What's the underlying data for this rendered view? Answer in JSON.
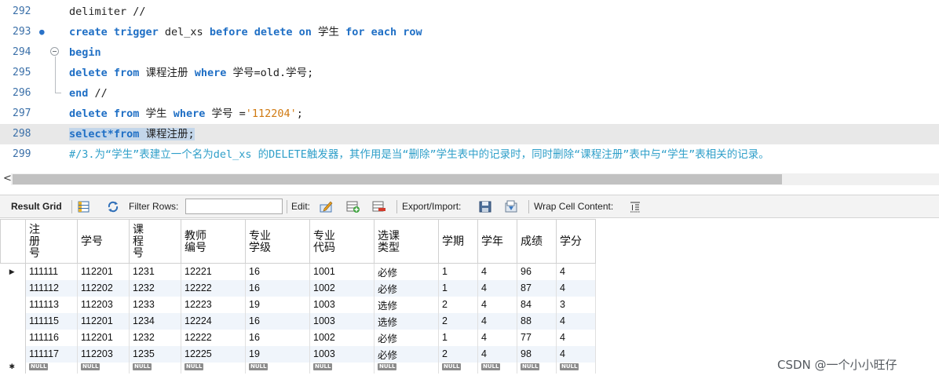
{
  "editor": {
    "lines": [
      {
        "num": "292",
        "marker": "",
        "fold": "",
        "tokens": [
          {
            "t": "delimiter //",
            "c": "plain"
          }
        ]
      },
      {
        "num": "293",
        "marker": "●",
        "fold": "",
        "tokens": [
          {
            "t": "create trigger ",
            "c": "kw"
          },
          {
            "t": "del_xs ",
            "c": "plain"
          },
          {
            "t": "before delete on ",
            "c": "kw"
          },
          {
            "t": "学生 ",
            "c": "plain"
          },
          {
            "t": "for each row",
            "c": "kw"
          }
        ]
      },
      {
        "num": "294",
        "marker": "",
        "fold": "open",
        "tokens": [
          {
            "t": "begin",
            "c": "kw"
          }
        ]
      },
      {
        "num": "295",
        "marker": "",
        "fold": "",
        "tokens": [
          {
            "t": "delete from ",
            "c": "kw"
          },
          {
            "t": "课程注册 ",
            "c": "plain"
          },
          {
            "t": "where ",
            "c": "kw"
          },
          {
            "t": "学号=old.学号;",
            "c": "plain"
          }
        ]
      },
      {
        "num": "296",
        "marker": "",
        "fold": "",
        "tokens": [
          {
            "t": "end ",
            "c": "kw"
          },
          {
            "t": "//",
            "c": "plain"
          }
        ]
      },
      {
        "num": "297",
        "marker": "",
        "fold": "",
        "tokens": [
          {
            "t": "delete from ",
            "c": "kw"
          },
          {
            "t": "学生 ",
            "c": "plain"
          },
          {
            "t": "where ",
            "c": "kw"
          },
          {
            "t": "学号 =",
            "c": "plain"
          },
          {
            "t": "'112204'",
            "c": "str"
          },
          {
            "t": ";",
            "c": "plain"
          }
        ]
      },
      {
        "num": "298",
        "marker": "",
        "fold": "",
        "current": true,
        "tokens": [
          {
            "t": "select*from ",
            "c": "kw sel"
          },
          {
            "t": "课程注册;",
            "c": "plain sel"
          }
        ]
      },
      {
        "num": "299",
        "marker": "",
        "fold": "",
        "tokens": [
          {
            "t": "#/3.为“学生”表建立一个名为del_xs 的DELETE触发器，其作用是当“删除”学生表中的记录时，同时删除“课程注册”表中与“学生”表相关的记录。",
            "c": "cmt"
          }
        ]
      }
    ]
  },
  "scrollbar": {
    "left_arrow": "<"
  },
  "toolbar": {
    "result_grid": "Result Grid",
    "filter_rows": "Filter Rows:",
    "filter_value": "",
    "edit": "Edit:",
    "export_import": "Export/Import:",
    "wrap_cell": "Wrap Cell Content:"
  },
  "grid": {
    "columns": [
      "注册号",
      "学号",
      "课程号",
      "教师编号",
      "专业学级",
      "专业代码",
      "选课类型",
      "学期",
      "学年",
      "成绩",
      "学分"
    ],
    "rows": [
      [
        "111111",
        "112201",
        "1231",
        "12221",
        "16",
        "1001",
        "必修",
        "1",
        "4",
        "96",
        "4"
      ],
      [
        "111112",
        "112202",
        "1232",
        "12222",
        "16",
        "1002",
        "必修",
        "1",
        "4",
        "87",
        "4"
      ],
      [
        "111113",
        "112203",
        "1233",
        "12223",
        "19",
        "1003",
        "选修",
        "2",
        "4",
        "84",
        "3"
      ],
      [
        "111115",
        "112201",
        "1234",
        "12224",
        "16",
        "1003",
        "选修",
        "2",
        "4",
        "88",
        "4"
      ],
      [
        "111116",
        "112201",
        "1232",
        "12222",
        "16",
        "1002",
        "必修",
        "1",
        "4",
        "77",
        "4"
      ],
      [
        "111117",
        "112203",
        "1235",
        "12225",
        "19",
        "1003",
        "必修",
        "2",
        "4",
        "98",
        "4"
      ]
    ],
    "current_row_marker": "▶",
    "new_row_marker": "✱",
    "null_label": "NULL"
  },
  "watermark": "CSDN @一个小小旺仔",
  "colors": {
    "keyword": "#1f6fc5",
    "string": "#d07a12",
    "comment": "#2f9fc9",
    "selection": "#c3d6ea",
    "row_alt": "#f0f5fb"
  }
}
